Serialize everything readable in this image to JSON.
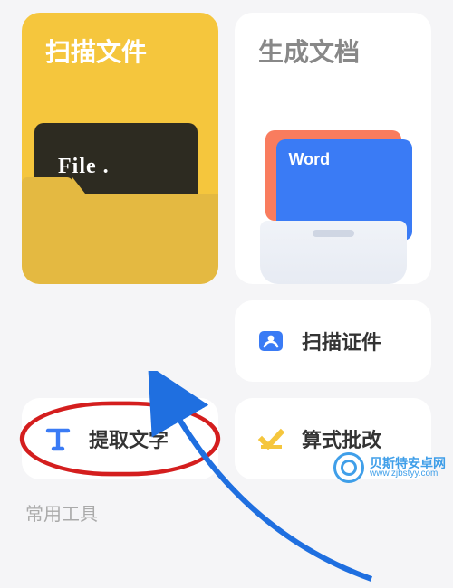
{
  "cards": {
    "scan_file": {
      "title": "扫描文件",
      "file_label": "File ."
    },
    "generate_doc": {
      "title": "生成文档",
      "word_label": "Word"
    },
    "scan_id": {
      "label": "扫描证件"
    },
    "extract_text": {
      "label": "提取文字"
    },
    "formula_check": {
      "label": "算式批改"
    }
  },
  "sections": {
    "tools_title": "常用工具"
  },
  "watermark": {
    "name": "贝斯特安卓网",
    "url": "www.zjbstyy.com"
  }
}
